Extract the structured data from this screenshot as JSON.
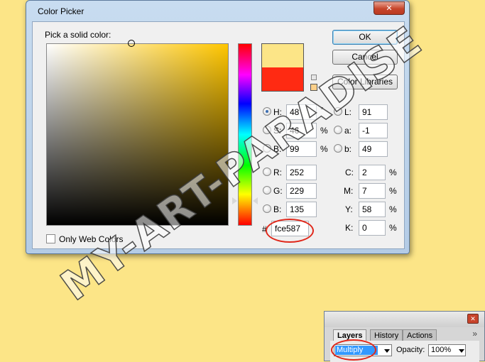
{
  "dialog": {
    "title": "Color Picker",
    "close_glyph": "✕",
    "pick_label": "Pick a solid color:",
    "buttons": {
      "ok": "OK",
      "cancel": "Cancel",
      "libraries": "Color Libraries"
    },
    "only_web_colors": "Only Web Colors",
    "new_color": "#fce587",
    "current_color": "#ff2a12",
    "hsb": {
      "h_label": "H:",
      "h": "48",
      "h_unit": "°",
      "s_label": "S:",
      "s": "46",
      "s_unit": "%",
      "b_label": "B:",
      "b": "99",
      "b_unit": "%"
    },
    "rgb": {
      "r_label": "R:",
      "r": "252",
      "g_label": "G:",
      "g": "229",
      "b_label": "B:",
      "b": "135"
    },
    "lab": {
      "l_label": "L:",
      "l": "91",
      "a_label": "a:",
      "a": "-1",
      "b_label": "b:",
      "b": "49"
    },
    "cmyk": {
      "c_label": "C:",
      "c": "2",
      "c_unit": "%",
      "m_label": "M:",
      "m": "7",
      "m_unit": "%",
      "y_label": "Y:",
      "y": "58",
      "y_unit": "%",
      "k_label": "K:",
      "k": "0",
      "k_unit": "%"
    },
    "hex_prefix": "#",
    "hex": "fce587"
  },
  "layers_panel": {
    "close_glyph": "✕",
    "collapse_glyph": "»",
    "tabs": [
      "Layers",
      "History",
      "Actions"
    ],
    "blend_mode": "Multiply",
    "opacity_label": "Opacity:",
    "opacity_value": "100%"
  },
  "watermark": "MY-ART-PARADISE"
}
